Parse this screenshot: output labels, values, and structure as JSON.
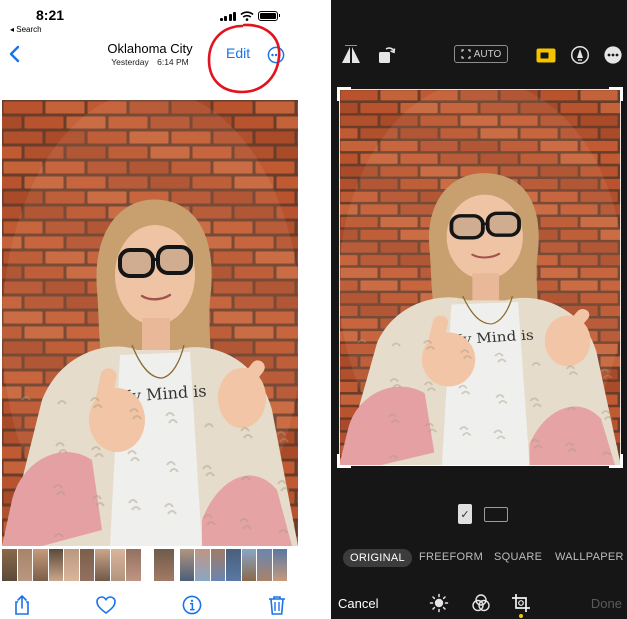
{
  "left_pane": {
    "status": {
      "time": "8:21",
      "back_app": "◂ Search"
    },
    "nav": {
      "title": "Oklahoma City",
      "subtitle_day": "Yesterday",
      "subtitle_time": "6:14 PM",
      "edit_label": "Edit"
    },
    "photo_shirt_text": "My Mind is",
    "thumbnail_count": 17
  },
  "right_pane": {
    "auto_label": "AUTO",
    "photo_shirt_text": "My Mind is",
    "aspect": {
      "selected": "portrait",
      "check": "✓"
    },
    "modes": [
      {
        "label": "ORIGINAL",
        "active": true
      },
      {
        "label": "FREEFORM",
        "active": false
      },
      {
        "label": "SQUARE",
        "active": false
      },
      {
        "label": "WALLPAPER",
        "active": false
      }
    ],
    "cancel_label": "Cancel",
    "done_label": "Done"
  },
  "colors": {
    "accent_blue": "#1a73e8",
    "annotation_red": "#e0141e",
    "crop_yellow": "#f5c400",
    "editor_bg": "#161616",
    "brick": "#b8532e",
    "mortar": "#6a3d2a"
  },
  "icons": {
    "left_nav": [
      "chevron-left-icon",
      "ellipsis-circle-icon"
    ],
    "left_bottom": [
      "share-icon",
      "heart-icon",
      "info-icon",
      "trash-icon"
    ],
    "right_top": [
      "flip-icon",
      "rotate-icon",
      "crop-auto-icon",
      "aspect-ratio-icon",
      "markup-pen-icon",
      "ellipsis-circle-icon"
    ],
    "right_bottom": [
      "adjust-icon",
      "filters-icon",
      "crop-icon"
    ]
  }
}
